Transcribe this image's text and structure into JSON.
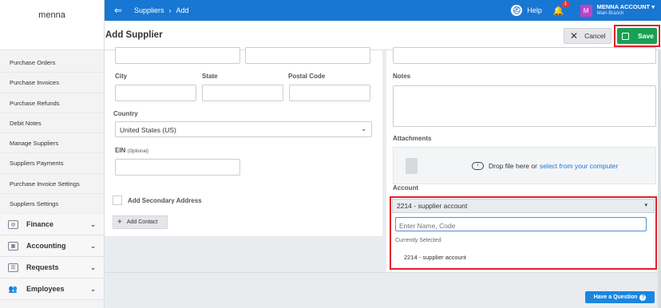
{
  "brand": "menna",
  "sidebar": {
    "sub_items": [
      "Purchase Orders",
      "Purchase Invoices",
      "Purchase Refunds",
      "Debit Notes",
      "Manage Suppliers",
      "Suppliers Payments",
      "Purchase Invoice Settings",
      "Suppliers Settings"
    ],
    "main_items": [
      {
        "label": "Finance",
        "icon": "finance-icon"
      },
      {
        "label": "Accounting",
        "icon": "accounting-icon"
      },
      {
        "label": "Requests",
        "icon": "requests-icon"
      },
      {
        "label": "Employees",
        "icon": "employees-icon"
      }
    ]
  },
  "topbar": {
    "breadcrumb_1": "Suppliers",
    "breadcrumb_sep": "›",
    "breadcrumb_2": "Add",
    "help": "Help",
    "notification_count": "1",
    "avatar_letter": "M",
    "account_name": "MENNA ACCOUNT",
    "branch": "Main Branch"
  },
  "titlebar": {
    "title": "Add Supplier",
    "cancel": "Cancel",
    "save": "Save"
  },
  "form": {
    "city_label": "City",
    "state_label": "State",
    "postal_label": "Postal Code",
    "country_label": "Country",
    "country_value": "United States (US)",
    "ein_label": "EIN",
    "ein_hint": "(Optional)",
    "secondary_address": "Add Secondary Address",
    "add_contact": "Add Contact",
    "notes_label": "Notes",
    "attachments_label": "Attachments",
    "drop_text": "Drop file here or",
    "drop_link": "select from your computer",
    "account_label": "Account",
    "account_value": "2214 - supplier account",
    "account_search_placeholder": "Enter Name, Code",
    "currently_selected": "Currently Selected",
    "account_option": "2214 - supplier account"
  },
  "help_button": "Have a Question",
  "colors": {
    "primary": "#1877d2",
    "save": "#1aa054",
    "highlight": "#e0202a"
  }
}
